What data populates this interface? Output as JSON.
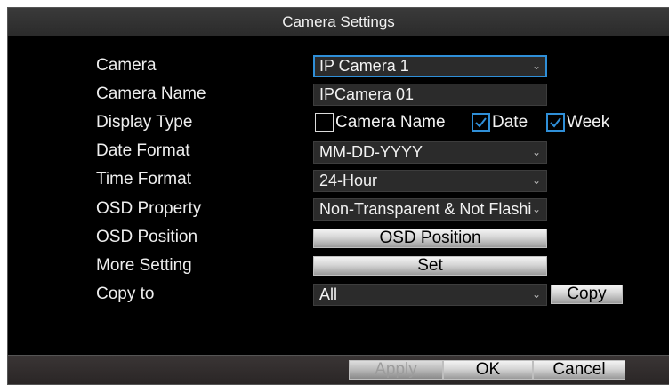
{
  "dialog": {
    "title": "Camera Settings"
  },
  "rows": {
    "camera": {
      "label": "Camera",
      "value": "IP Camera 1"
    },
    "camera_name": {
      "label": "Camera Name",
      "value": "IPCamera 01"
    },
    "display_type": {
      "label": "Display Type",
      "options": [
        {
          "label": "Camera Name",
          "checked": false
        },
        {
          "label": "Date",
          "checked": true
        },
        {
          "label": "Week",
          "checked": true
        }
      ]
    },
    "date_format": {
      "label": "Date Format",
      "value": "MM-DD-YYYY"
    },
    "time_format": {
      "label": "Time Format",
      "value": "24-Hour"
    },
    "osd_property": {
      "label": "OSD Property",
      "value": "Non-Transparent & Not Flashing"
    },
    "osd_position": {
      "label": "OSD Position",
      "button": "OSD Position"
    },
    "more_setting": {
      "label": "More Setting",
      "button": "Set"
    },
    "copy_to": {
      "label": "Copy to",
      "value": "All",
      "button": "Copy"
    }
  },
  "footer": {
    "apply": "Apply",
    "ok": "OK",
    "cancel": "Cancel"
  },
  "icons": {
    "dropdown": "chevron-down-icon",
    "check": "check-icon"
  },
  "colors": {
    "accent": "#2f8fd8",
    "background": "#000000",
    "field": "#2b2b2b"
  }
}
